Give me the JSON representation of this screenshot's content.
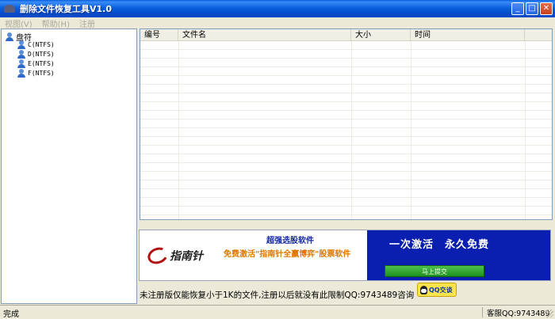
{
  "window": {
    "title": "删除文件恢复工具V1.0",
    "minimize": "_",
    "maximize": "□",
    "close": "✕"
  },
  "menu": {
    "items": [
      "视图(V)",
      "帮助(H)",
      "注册"
    ]
  },
  "tree": {
    "root": "盘符",
    "drives": [
      "C(NTFS)",
      "D(NTFS)",
      "E(NTFS)",
      "F(NTFS)"
    ]
  },
  "table": {
    "columns": [
      "编号",
      "文件名",
      "大小",
      "时间"
    ],
    "rows": []
  },
  "banner": {
    "logo_text": "指南针",
    "line1": "超强选股软件",
    "line2": "免费激活\"指南针全赢博弈\"股票软件",
    "slogan": "一次激活　永久免费",
    "button": "马上提交"
  },
  "notice": "未注册版仅能恢复小于1K的文件,注册以后就没有此限制QQ:9743489咨询",
  "qq_button": "QQ交谈",
  "status": {
    "left": "完成",
    "right": "客服QQ:9743489"
  }
}
